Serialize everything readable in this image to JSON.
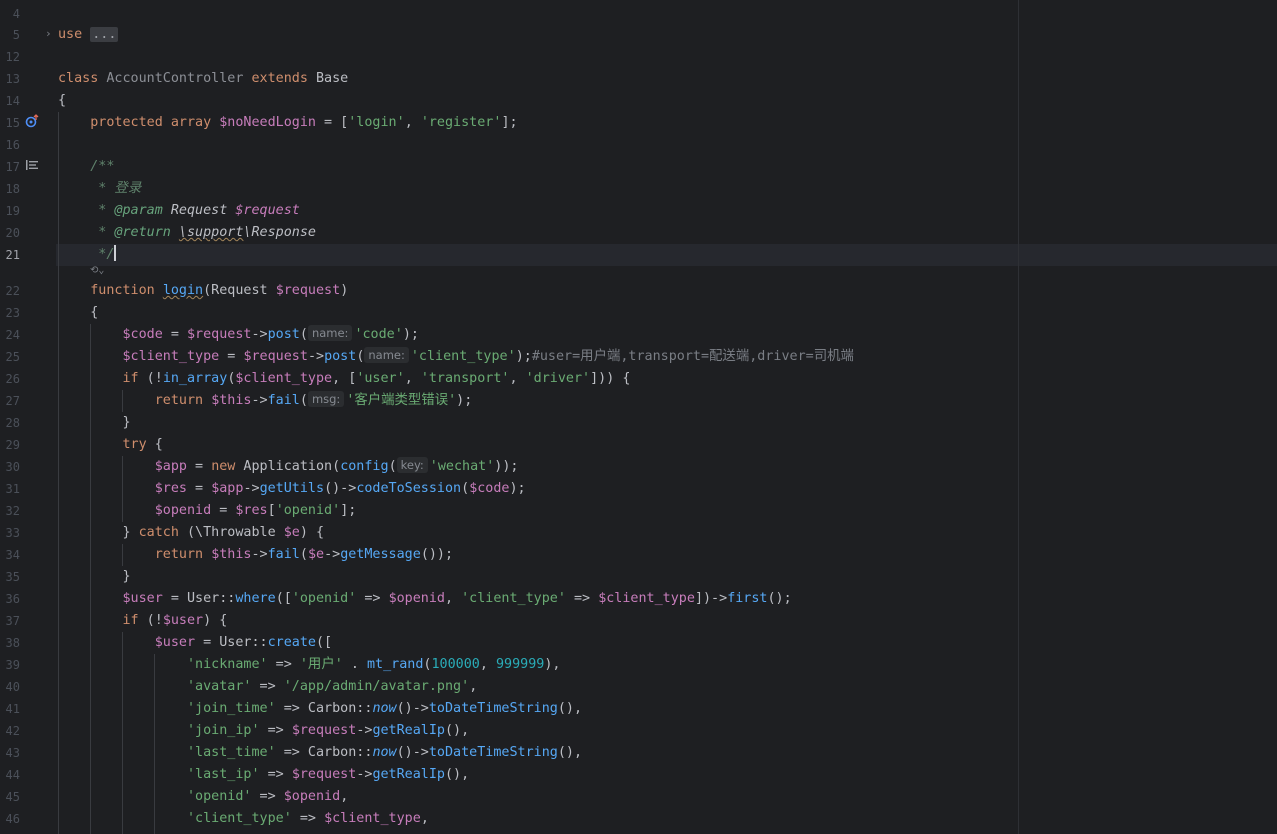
{
  "editor": {
    "line_numbers": [
      "4",
      "5",
      "12",
      "13",
      "14",
      "15",
      "16",
      "17",
      "18",
      "19",
      "20",
      "21",
      "22",
      "23",
      "24",
      "25",
      "26",
      "27",
      "28",
      "29",
      "30",
      "31",
      "32",
      "33",
      "34",
      "35",
      "36",
      "37",
      "38",
      "39",
      "40",
      "41",
      "42",
      "43",
      "44",
      "45",
      "46"
    ],
    "current_line": "21",
    "icons": {
      "implements": "override-method-icon",
      "doc_render": "render-doc-icon",
      "fold": "chevron-right-icon",
      "doc_toggle": "doc-toggle-icon"
    }
  },
  "code": {
    "l5_use": "use",
    "l5_fold": "...",
    "l13": {
      "class": "class",
      "name": "AccountController",
      "extends": "extends",
      "base": "Base"
    },
    "brace_open": "{",
    "brace_close": "}",
    "l15": {
      "protected": "protected",
      "array": "array",
      "var": "$noNeedLogin",
      "eq": " = [",
      "s1": "'login'",
      "comma": ", ",
      "s2": "'register'",
      "end": "];"
    },
    "l17": "/**",
    "l18": " * 登录",
    "l19": {
      "star": " * ",
      "tag": "@param",
      "type": " Request ",
      "var": "$request"
    },
    "l20": {
      "star": " * ",
      "tag": "@return",
      "sp": " ",
      "ns1": "\\support",
      "ns2": "\\Response"
    },
    "l21": " */",
    "l22": {
      "function": "function",
      "name": "login",
      "open": "(Request ",
      "var": "$request",
      "close": ")"
    },
    "l24": {
      "var": "$code",
      "eq": " = ",
      "req": "$request",
      "arrow": "->",
      "fn": "post",
      "open": "(",
      "hint": "name:",
      "str": "'code'",
      "end": ");"
    },
    "l25": {
      "var": "$client_type",
      "eq": " = ",
      "req": "$request",
      "arrow": "->",
      "fn": "post",
      "open": "(",
      "hint": "name:",
      "str": "'client_type'",
      "end": ");",
      "comment": "#user=用户端,transport=配送端,driver=司机端"
    },
    "l26": {
      "if": "if",
      "p1": " (!",
      "fn": "in_array",
      "p2": "(",
      "var": "$client_type",
      "p3": ", [",
      "s1": "'user'",
      "c1": ", ",
      "s2": "'transport'",
      "c2": ", ",
      "s3": "'driver'",
      "end": "])) {"
    },
    "l27": {
      "return": "return",
      "this": "$this",
      "arrow": "->",
      "fn": "fail",
      "open": "(",
      "hint": "msg:",
      "str": "'客户端类型错误'",
      "end": ");"
    },
    "l29": {
      "try": "try",
      "end": " {"
    },
    "l30": {
      "var": "$app",
      "eq": " = ",
      "new": "new",
      "cls": " Application(",
      "fn": "config",
      "open": "(",
      "hint": "key:",
      "str": "'wechat'",
      "end": "));"
    },
    "l31": {
      "var": "$res",
      "eq": " = ",
      "app": "$app",
      "a1": "->",
      "fn1": "getUtils",
      "p1": "()->",
      "fn2": "codeToSession",
      "p2": "(",
      "code": "$code",
      "end": ");"
    },
    "l32": {
      "var": "$openid",
      "eq": " = ",
      "res": "$res",
      "open": "[",
      "str": "'openid'",
      "end": "];"
    },
    "l33": {
      "close": "} ",
      "catch": "catch",
      "p1": " (\\Throwable ",
      "var": "$e",
      "end": ") {"
    },
    "l34": {
      "return": "return",
      "this": "$this",
      "arrow": "->",
      "fn": "fail",
      "p1": "(",
      "e": "$e",
      "a2": "->",
      "fn2": "getMessage",
      "end": "());"
    },
    "l36": {
      "var": "$user",
      "eq": " = User::",
      "fn": "where",
      "p1": "([",
      "s1": "'openid'",
      "op1": " => ",
      "v1": "$openid",
      "c1": ", ",
      "s2": "'client_type'",
      "op2": " => ",
      "v2": "$client_type",
      "p2": "])->",
      "fn2": "first",
      "end": "();"
    },
    "l37": {
      "if": "if",
      "p1": " (!",
      "var": "$user",
      "end": ") {"
    },
    "l38": {
      "var": "$user",
      "eq": " = User::",
      "fn": "create",
      "end": "(["
    },
    "l39": {
      "key": "'nickname'",
      "op": " => ",
      "str": "'用户'",
      "dot": " . ",
      "fn": "mt_rand",
      "p1": "(",
      "n1": "100000",
      "c": ", ",
      "n2": "999999",
      "end": "),"
    },
    "l40": {
      "key": "'avatar'",
      "op": " => ",
      "str": "'/app/admin/avatar.png'",
      "end": ","
    },
    "l41": {
      "key": "'join_time'",
      "op": " => Carbon::",
      "fn": "now",
      "p": "()->",
      "fn2": "toDateTimeString",
      "end": "(),"
    },
    "l42": {
      "key": "'join_ip'",
      "op": " => ",
      "var": "$request",
      "a": "->",
      "fn": "getRealIp",
      "end": "(),"
    },
    "l43": {
      "key": "'last_time'",
      "op": " => Carbon::",
      "fn": "now",
      "p": "()->",
      "fn2": "toDateTimeString",
      "end": "(),"
    },
    "l44": {
      "key": "'last_ip'",
      "op": " => ",
      "var": "$request",
      "a": "->",
      "fn": "getRealIp",
      "end": "(),"
    },
    "l45": {
      "key": "'openid'",
      "op": " => ",
      "var": "$openid",
      "end": ","
    },
    "l46": {
      "key": "'client_type'",
      "op": " => ",
      "var": "$client_type",
      "end": ","
    }
  }
}
